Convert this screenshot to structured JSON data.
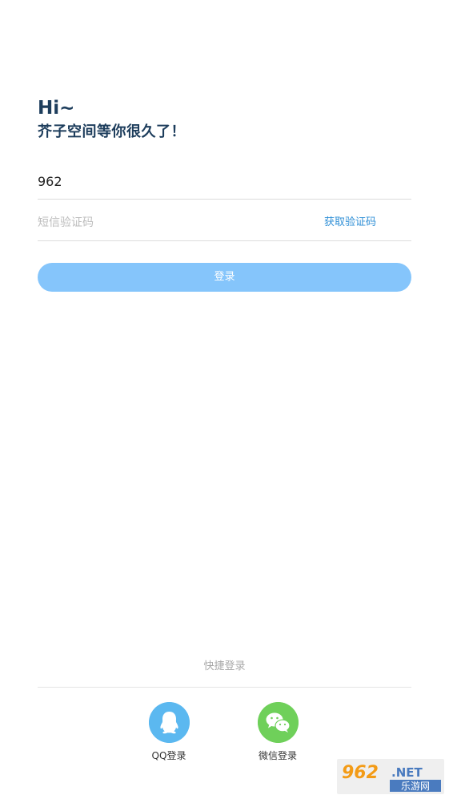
{
  "greeting": {
    "hi": "Hi~",
    "subtitle": "芥子空间等你很久了！"
  },
  "form": {
    "phone_value": "962",
    "code_placeholder": "短信验证码",
    "get_code_label": "获取验证码",
    "login_label": "登录"
  },
  "quick_login": {
    "title": "快捷登录",
    "qq_label": "QQ登录",
    "wechat_label": "微信登录"
  },
  "watermark": {
    "top": "962",
    "dot": ".NET",
    "bottom": "乐游网"
  },
  "colors": {
    "title": "#1d3d5c",
    "accent": "#2f8fd6",
    "login_button": "#85c5fb",
    "qq": "#5bb8f0",
    "wechat": "#6fd05a"
  },
  "icons": {
    "qq": "qq-penguin-icon",
    "wechat": "wechat-bubbles-icon"
  }
}
